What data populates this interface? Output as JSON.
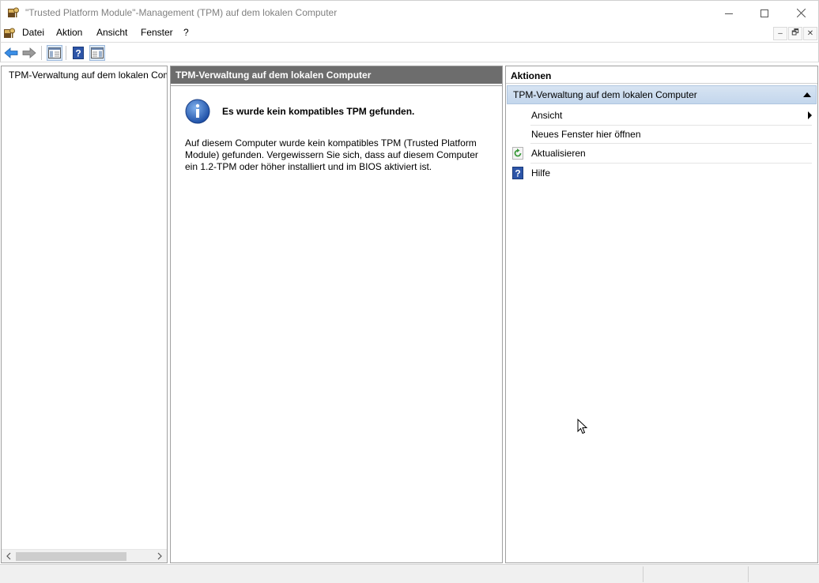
{
  "window": {
    "title": "\"Trusted Platform Module\"-Management (TPM) auf dem lokalen Computer",
    "minimize_symbol": "—",
    "maximize_symbol": "☐",
    "close_symbol": "✕"
  },
  "menubar": {
    "items": [
      "Datei",
      "Aktion",
      "Ansicht",
      "Fenster",
      "?"
    ],
    "mdi_buttons": [
      "–",
      "🗗",
      "✕"
    ]
  },
  "toolbar": {
    "buttons": [
      "back-arrow-icon",
      "forward-arrow-icon",
      "show-hide-tree-icon",
      "help-icon",
      "show-hide-action-pane-icon"
    ]
  },
  "tree": {
    "root_label": "TPM-Verwaltung auf dem lokalen Computer"
  },
  "center": {
    "header": "TPM-Verwaltung auf dem lokalen Computer",
    "message_title": "Es wurde kein kompatibles TPM gefunden.",
    "message_body": "Auf diesem Computer wurde kein kompatibles TPM (Trusted Platform Module) gefunden. Vergewissern Sie sich, dass auf diesem Computer ein 1.2-TPM oder höher installiert und im BIOS aktiviert ist."
  },
  "actions": {
    "header": "Aktionen",
    "section_title": "TPM-Verwaltung auf dem lokalen Computer",
    "items": [
      {
        "label": "Ansicht",
        "icon": "",
        "has_submenu": true
      },
      {
        "label": "Neues Fenster hier öffnen",
        "icon": "",
        "has_submenu": false
      },
      {
        "label": "Aktualisieren",
        "icon": "refresh-icon",
        "has_submenu": false
      },
      {
        "label": "Hilfe",
        "icon": "help-icon",
        "has_submenu": false
      }
    ]
  },
  "colors": {
    "center_header_bg": "#6d6d6d",
    "actions_section_bg": "#c9daee",
    "pane_border": "#a0a0a0"
  }
}
